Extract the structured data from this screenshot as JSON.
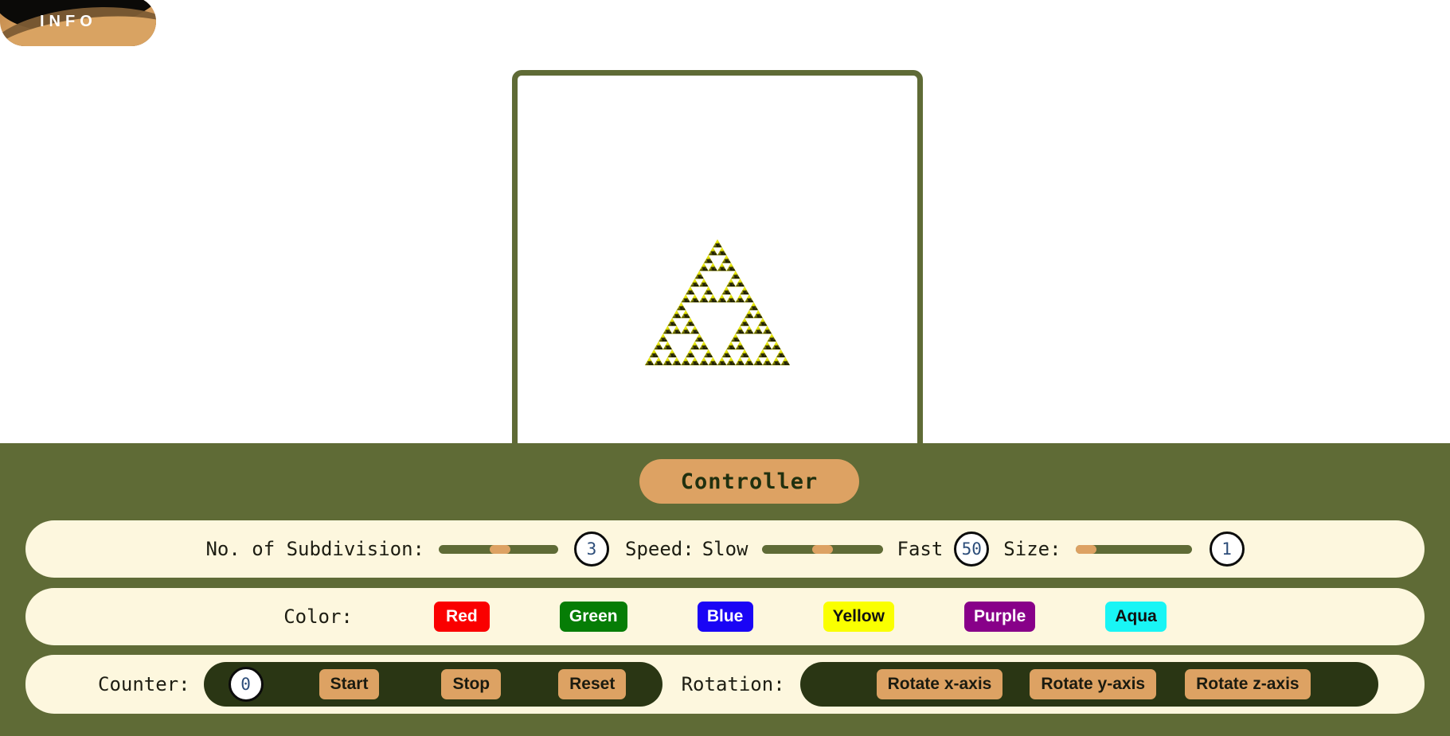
{
  "info_badge": {
    "label": "INFO"
  },
  "stage": {
    "fractal_name": "sierpinski-triangle-fractal",
    "fractal_color": "#e8e800"
  },
  "controller": {
    "title": "Controller",
    "sliders_row": {
      "subdivision_label": "No. of Subdivision:",
      "subdivision_value": "3",
      "subdivision_percent": 52,
      "speed_label": "Speed:",
      "speed_min_label": "Slow",
      "speed_max_label": "Fast",
      "speed_value": "50",
      "speed_percent": 50,
      "size_label": "Size:",
      "size_value": "1",
      "size_percent": 0
    },
    "colors_row": {
      "label": "Color:",
      "buttons": [
        {
          "label": "Red",
          "bg": "#fa0000",
          "fg": "#ffffff"
        },
        {
          "label": "Green",
          "bg": "#067d06",
          "fg": "#ffffff"
        },
        {
          "label": "Blue",
          "bg": "#1a05f5",
          "fg": "#ffffff"
        },
        {
          "label": "Yellow",
          "bg": "#faff00",
          "fg": "#111111"
        },
        {
          "label": "Purple",
          "bg": "#880089",
          "fg": "#ffffff"
        },
        {
          "label": "Aqua",
          "bg": "#19f5f5",
          "fg": "#111111"
        }
      ]
    },
    "counter_row": {
      "counter_label": "Counter:",
      "counter_value": "0",
      "start_label": "Start",
      "stop_label": "Stop",
      "reset_label": "Reset",
      "rotation_label": "Rotation:",
      "rotate_x_label": "Rotate x-axis",
      "rotate_y_label": "Rotate y-axis",
      "rotate_z_label": "Rotate z-axis"
    }
  },
  "palette": {
    "panel_green": "#5f6b36",
    "cream": "#fdf7de",
    "tan": "#dda263",
    "dark_olive": "#2a3614"
  }
}
